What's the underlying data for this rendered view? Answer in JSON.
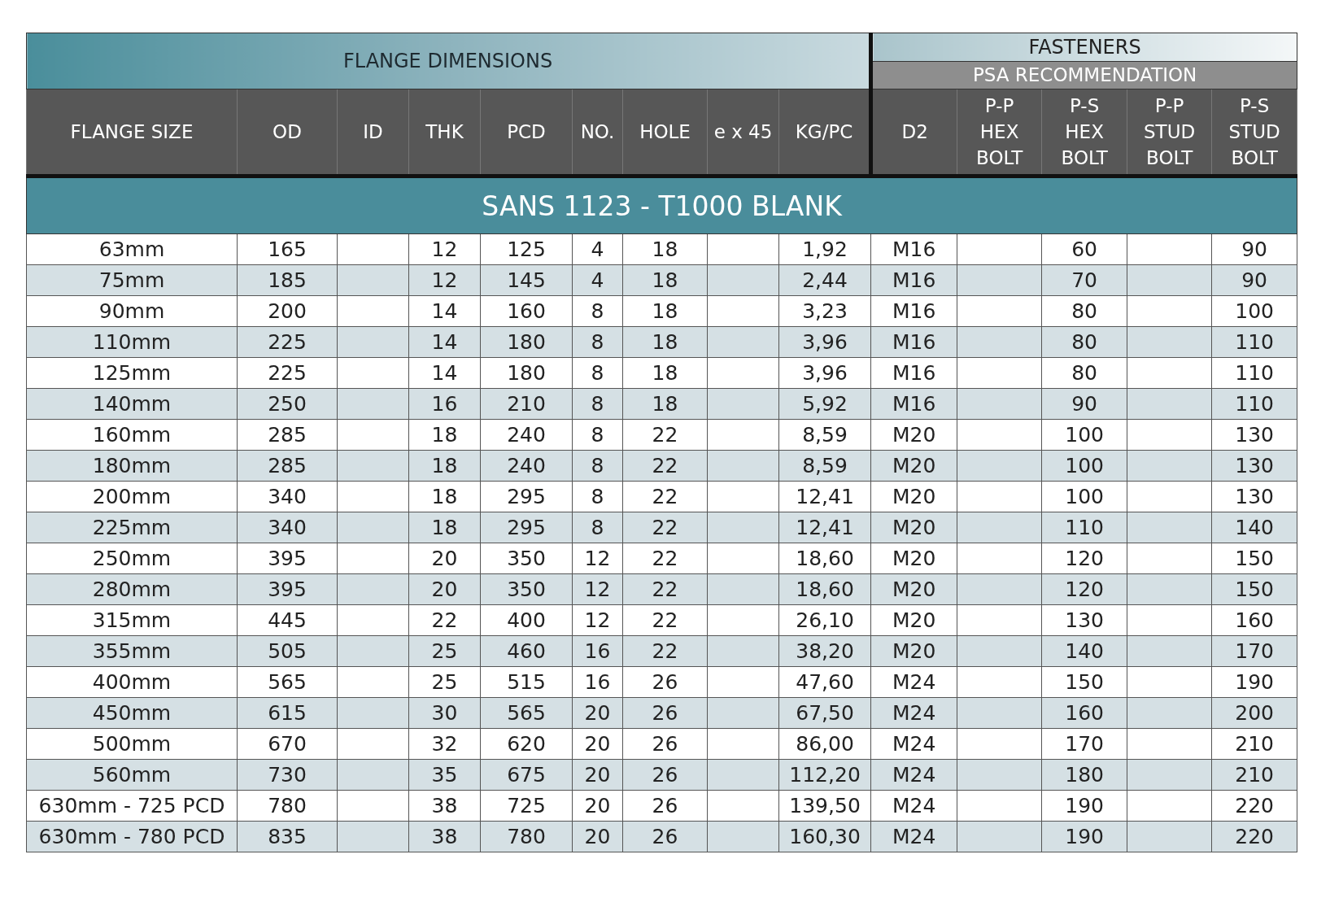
{
  "groups": {
    "dimensions": "FLANGE DIMENSIONS",
    "fasteners": "FASTENERS",
    "recommendation": "PSA RECOMMENDATION"
  },
  "columns": [
    {
      "lines": [
        "FLANGE SIZE"
      ]
    },
    {
      "lines": [
        "OD"
      ]
    },
    {
      "lines": [
        "ID"
      ]
    },
    {
      "lines": [
        "THK"
      ]
    },
    {
      "lines": [
        "PCD"
      ]
    },
    {
      "lines": [
        "NO."
      ]
    },
    {
      "lines": [
        "HOLE"
      ]
    },
    {
      "lines": [
        "e x 45"
      ]
    },
    {
      "lines": [
        "KG/PC"
      ]
    },
    {
      "lines": [
        "D2"
      ]
    },
    {
      "lines": [
        "P-P",
        "HEX",
        "BOLT"
      ]
    },
    {
      "lines": [
        "P-S",
        "HEX",
        "BOLT"
      ]
    },
    {
      "lines": [
        "P-P",
        "STUD",
        "BOLT"
      ]
    },
    {
      "lines": [
        "P-S",
        "STUD",
        "BOLT"
      ]
    }
  ],
  "section_title": "SANS 1123 - T1000 BLANK",
  "rows": [
    [
      "63mm",
      "165",
      null,
      "12",
      "125",
      "4",
      "18",
      null,
      "1,92",
      "M16",
      null,
      "60",
      null,
      "90"
    ],
    [
      "75mm",
      "185",
      null,
      "12",
      "145",
      "4",
      "18",
      null,
      "2,44",
      "M16",
      null,
      "70",
      null,
      "90"
    ],
    [
      "90mm",
      "200",
      null,
      "14",
      "160",
      "8",
      "18",
      null,
      "3,23",
      "M16",
      null,
      "80",
      null,
      "100"
    ],
    [
      "110mm",
      "225",
      null,
      "14",
      "180",
      "8",
      "18",
      null,
      "3,96",
      "M16",
      null,
      "80",
      null,
      "110"
    ],
    [
      "125mm",
      "225",
      null,
      "14",
      "180",
      "8",
      "18",
      null,
      "3,96",
      "M16",
      null,
      "80",
      null,
      "110"
    ],
    [
      "140mm",
      "250",
      null,
      "16",
      "210",
      "8",
      "18",
      null,
      "5,92",
      "M16",
      null,
      "90",
      null,
      "110"
    ],
    [
      "160mm",
      "285",
      null,
      "18",
      "240",
      "8",
      "22",
      null,
      "8,59",
      "M20",
      null,
      "100",
      null,
      "130"
    ],
    [
      "180mm",
      "285",
      null,
      "18",
      "240",
      "8",
      "22",
      null,
      "8,59",
      "M20",
      null,
      "100",
      null,
      "130"
    ],
    [
      "200mm",
      "340",
      null,
      "18",
      "295",
      "8",
      "22",
      null,
      "12,41",
      "M20",
      null,
      "100",
      null,
      "130"
    ],
    [
      "225mm",
      "340",
      null,
      "18",
      "295",
      "8",
      "22",
      null,
      "12,41",
      "M20",
      null,
      "110",
      null,
      "140"
    ],
    [
      "250mm",
      "395",
      null,
      "20",
      "350",
      "12",
      "22",
      null,
      "18,60",
      "M20",
      null,
      "120",
      null,
      "150"
    ],
    [
      "280mm",
      "395",
      null,
      "20",
      "350",
      "12",
      "22",
      null,
      "18,60",
      "M20",
      null,
      "120",
      null,
      "150"
    ],
    [
      "315mm",
      "445",
      null,
      "22",
      "400",
      "12",
      "22",
      null,
      "26,10",
      "M20",
      null,
      "130",
      null,
      "160"
    ],
    [
      "355mm",
      "505",
      null,
      "25",
      "460",
      "16",
      "22",
      null,
      "38,20",
      "M20",
      null,
      "140",
      null,
      "170"
    ],
    [
      "400mm",
      "565",
      null,
      "25",
      "515",
      "16",
      "26",
      null,
      "47,60",
      "M24",
      null,
      "150",
      null,
      "190"
    ],
    [
      "450mm",
      "615",
      null,
      "30",
      "565",
      "20",
      "26",
      null,
      "67,50",
      "M24",
      null,
      "160",
      null,
      "200"
    ],
    [
      "500mm",
      "670",
      null,
      "32",
      "620",
      "20",
      "26",
      null,
      "86,00",
      "M24",
      null,
      "170",
      null,
      "210"
    ],
    [
      "560mm",
      "730",
      null,
      "35",
      "675",
      "20",
      "26",
      null,
      "112,20",
      "M24",
      null,
      "180",
      null,
      "210"
    ],
    [
      "630mm - 725 PCD",
      "780",
      null,
      "38",
      "725",
      "20",
      "26",
      null,
      "139,50",
      "M24",
      null,
      "190",
      null,
      "220"
    ],
    [
      "630mm - 780 PCD",
      "835",
      null,
      "38",
      "780",
      "20",
      "26",
      null,
      "160,30",
      "M24",
      null,
      "190",
      null,
      "220"
    ]
  ]
}
